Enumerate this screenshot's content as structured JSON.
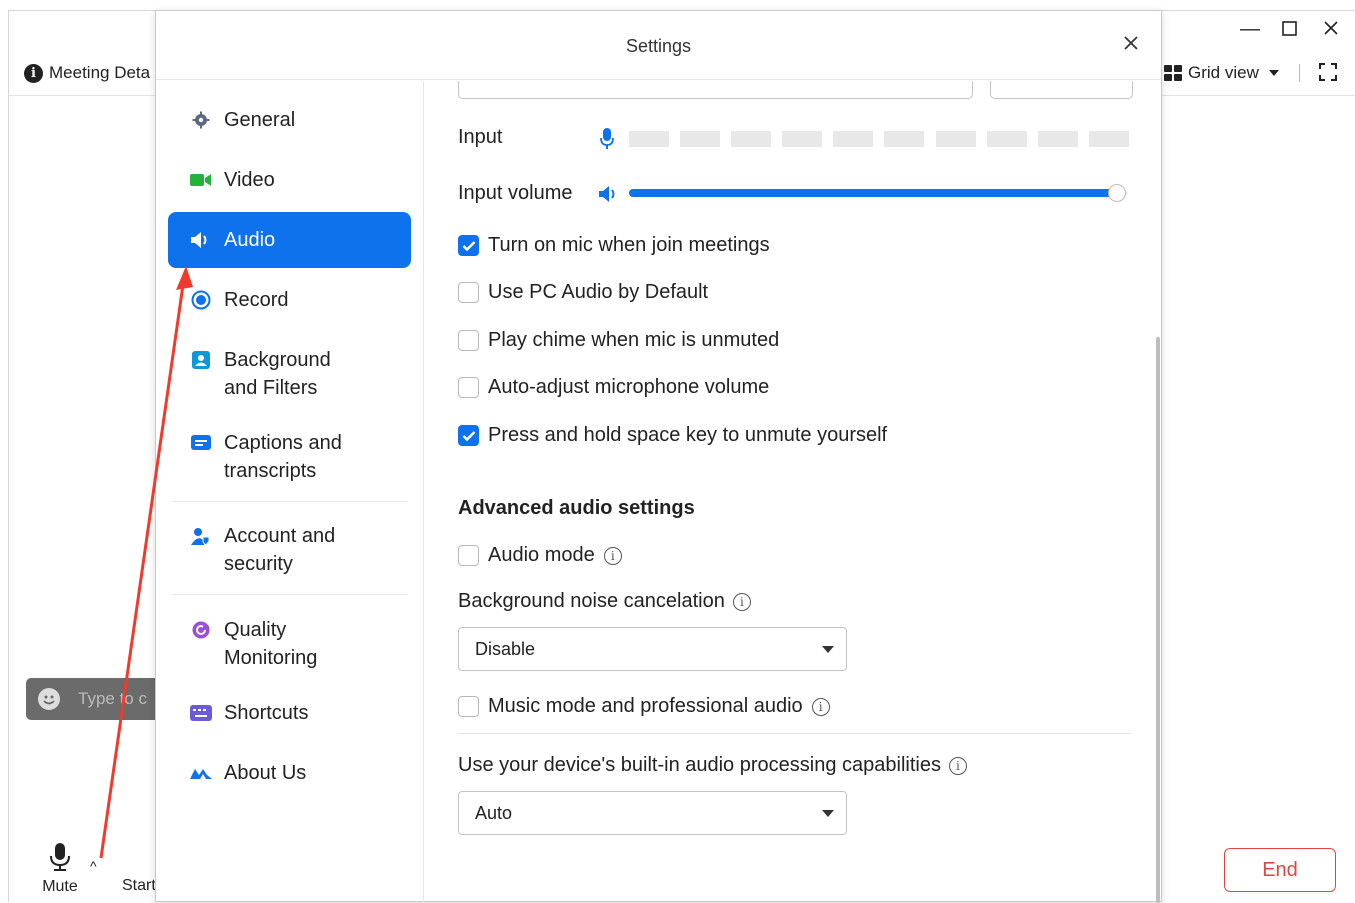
{
  "meeting": {
    "details_label": "Meeting Deta",
    "grid_view_label": "Grid view",
    "chat_placeholder": "Type to c",
    "mute_label": "Mute",
    "start_label": "Start",
    "end_label": "End"
  },
  "settings": {
    "title": "Settings",
    "nav": [
      {
        "label": "General",
        "icon": "gear-icon"
      },
      {
        "label": "Video",
        "icon": "video-camera-icon"
      },
      {
        "label": "Audio",
        "icon": "speaker-icon",
        "active": true
      },
      {
        "label": "Record",
        "icon": "record-icon"
      },
      {
        "label": "Background\nand Filters",
        "icon": "person-portrait-icon"
      },
      {
        "label": "Captions and\ntranscripts",
        "icon": "captions-icon"
      },
      {
        "label": "Account and\nsecurity",
        "icon": "account-shield-icon"
      },
      {
        "label": "Quality\nMonitoring",
        "icon": "quality-monitor-icon"
      },
      {
        "label": "Shortcuts",
        "icon": "keyboard-icon"
      },
      {
        "label": "About Us",
        "icon": "zoom-logo-icon"
      }
    ],
    "audio": {
      "input_label": "Input",
      "input_volume_label": "Input volume",
      "input_volume_level": 0.98,
      "checkboxes": [
        {
          "label": "Turn on mic when join meetings",
          "checked": true
        },
        {
          "label": "Use PC Audio by Default",
          "checked": false
        },
        {
          "label": "Play chime when mic is unmuted",
          "checked": false
        },
        {
          "label": "Auto-adjust microphone volume",
          "checked": false
        },
        {
          "label": "Press and hold space key to unmute yourself",
          "checked": true
        }
      ],
      "advanced_heading": "Advanced audio settings",
      "audio_mode_label": "Audio mode",
      "noise_label": "Background noise cancelation",
      "noise_value": "Disable",
      "music_mode_label": "Music mode and professional audio",
      "device_processing_label": "Use your device's built-in audio processing capabilities",
      "device_processing_value": "Auto"
    }
  },
  "colors": {
    "accent": "#0e72ed",
    "end_red": "#e0463f",
    "arrow_red": "#f03a2e"
  }
}
